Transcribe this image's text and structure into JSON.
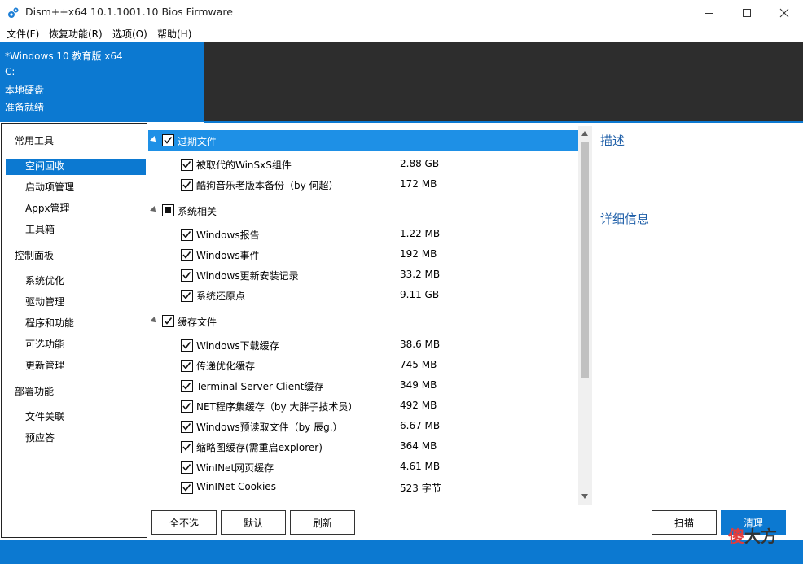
{
  "window": {
    "title": "Dism++x64 10.1.1001.10 Bios Firmware",
    "controls": {
      "minimize": "—",
      "maximize": "☐",
      "close": "✕"
    }
  },
  "menu": [
    "文件(F)",
    "恢复功能(R)",
    "选项(O)",
    "帮助(H)"
  ],
  "header": {
    "lines": [
      "*Windows 10 教育版 x64",
      "C:",
      "本地硬盘",
      "准备就绪"
    ]
  },
  "sidebar": {
    "sections": [
      {
        "title": "常用工具",
        "items": [
          "空间回收",
          "启动项管理",
          "Appx管理",
          "工具箱"
        ]
      },
      {
        "title": "控制面板",
        "items": [
          "系统优化",
          "驱动管理",
          "程序和功能",
          "可选功能",
          "更新管理"
        ]
      },
      {
        "title": "部署功能",
        "items": [
          "文件关联",
          "预应答"
        ]
      }
    ],
    "selected": "空间回收"
  },
  "tree": {
    "groups": [
      {
        "label": "过期文件",
        "state": "checked",
        "selected": true,
        "items": [
          {
            "label": "被取代的WinSxS组件",
            "size": "2.88 GB"
          },
          {
            "label": "酷狗音乐老版本备份（by 何超）",
            "size": "172 MB"
          }
        ]
      },
      {
        "label": "系统相关",
        "state": "partial",
        "selected": false,
        "items": [
          {
            "label": "Windows报告",
            "size": "1.22 MB"
          },
          {
            "label": "Windows事件",
            "size": "192 MB"
          },
          {
            "label": "Windows更新安装记录",
            "size": "33.2 MB"
          },
          {
            "label": "系统还原点",
            "size": "9.11 GB"
          }
        ]
      },
      {
        "label": "缓存文件",
        "state": "checked",
        "selected": false,
        "items": [
          {
            "label": "Windows下载缓存",
            "size": "38.6 MB"
          },
          {
            "label": "传递优化缓存",
            "size": "745 MB"
          },
          {
            "label": "Terminal Server Client缓存",
            "size": "349 MB"
          },
          {
            "label": "NET程序集缓存（by 大胖子技术员）",
            "size": "492 MB"
          },
          {
            "label": "Windows预读取文件（by 辰g.）",
            "size": "6.67 MB"
          },
          {
            "label": "缩略图缓存(需重启explorer)",
            "size": "364 MB"
          },
          {
            "label": "WinINet网页缓存",
            "size": "4.61 MB"
          },
          {
            "label": "WinINet Cookies",
            "size": "523 字节"
          }
        ]
      }
    ]
  },
  "right_panel": {
    "description_title": "描述",
    "details_title": "详细信息"
  },
  "buttons": {
    "select_none": "全不选",
    "default": "默认",
    "refresh": "刷新",
    "scan": "扫描",
    "clean": "清理"
  },
  "watermark": {
    "part1": "傻",
    "part2": "大方"
  },
  "colors": {
    "accent": "#0c79d1",
    "header_dark": "#2d2d2d",
    "selected_row": "#1e90e6",
    "title_blue": "#1f5fa8"
  }
}
